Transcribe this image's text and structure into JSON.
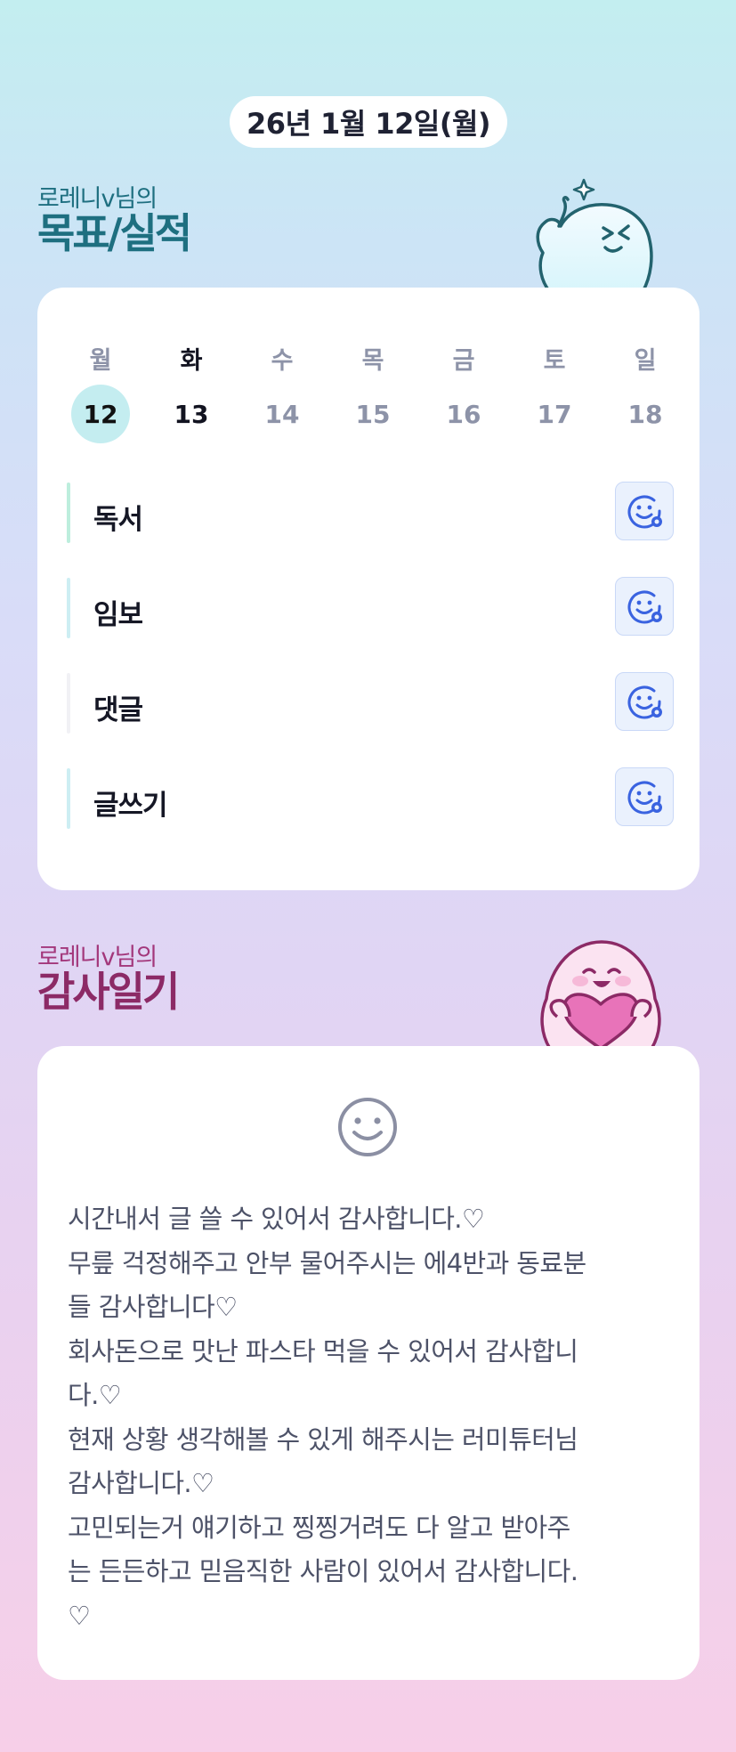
{
  "header": {
    "date": "26년 1월 12일(월)"
  },
  "goal_section": {
    "subtitle": "로레니v님의",
    "title": "목표/실적",
    "week": [
      {
        "day": "월",
        "date": "12",
        "selected": true,
        "tone": "dark"
      },
      {
        "day": "화",
        "date": "13",
        "selected": false,
        "tone": "dark"
      },
      {
        "day": "수",
        "date": "14",
        "selected": false,
        "tone": "gray"
      },
      {
        "day": "목",
        "date": "15",
        "selected": false,
        "tone": "gray"
      },
      {
        "day": "금",
        "date": "16",
        "selected": false,
        "tone": "gray"
      },
      {
        "day": "토",
        "date": "17",
        "selected": false,
        "tone": "gray"
      },
      {
        "day": "일",
        "date": "18",
        "selected": false,
        "tone": "gray"
      }
    ],
    "goals": [
      {
        "label": "독서",
        "bar_color": "#bdeedd",
        "icon": "add-reaction-icon"
      },
      {
        "label": "임보",
        "bar_color": "#cdeef3",
        "icon": "add-reaction-icon"
      },
      {
        "label": "댓글",
        "bar_color": "#f1f1f5",
        "icon": "add-reaction-icon"
      },
      {
        "label": "글쓰기",
        "bar_color": "#cdeef3",
        "icon": "add-reaction-icon"
      }
    ]
  },
  "thanks_section": {
    "subtitle": "로레니v님의",
    "title": "감사일기",
    "icon": "smiley-icon",
    "lines": [
      "시간내서 글 쓸 수 있어서 감사합니다.♡",
      "무릎 걱정해주고 안부 물어주시는 에4반과 동료분",
      "들 감사합니다♡",
      "회사돈으로 맛난 파스타 먹을 수 있어서 감사합니",
      "다.♡",
      "현재 상황 생각해볼 수 있게 해주시는 러미튜터님",
      "감사합니다.♡",
      "고민되는거 얘기하고 찡찡거려도 다 알고 받아주",
      "는 든든하고 믿음직한 사람이 있어서 감사합니다.",
      "♡"
    ]
  },
  "colors": {
    "accent_teal": "#1e6f80",
    "accent_magenta": "#8c2a66",
    "selected_day": "#c4edf0",
    "reaction_blue": "#3a63e0"
  }
}
